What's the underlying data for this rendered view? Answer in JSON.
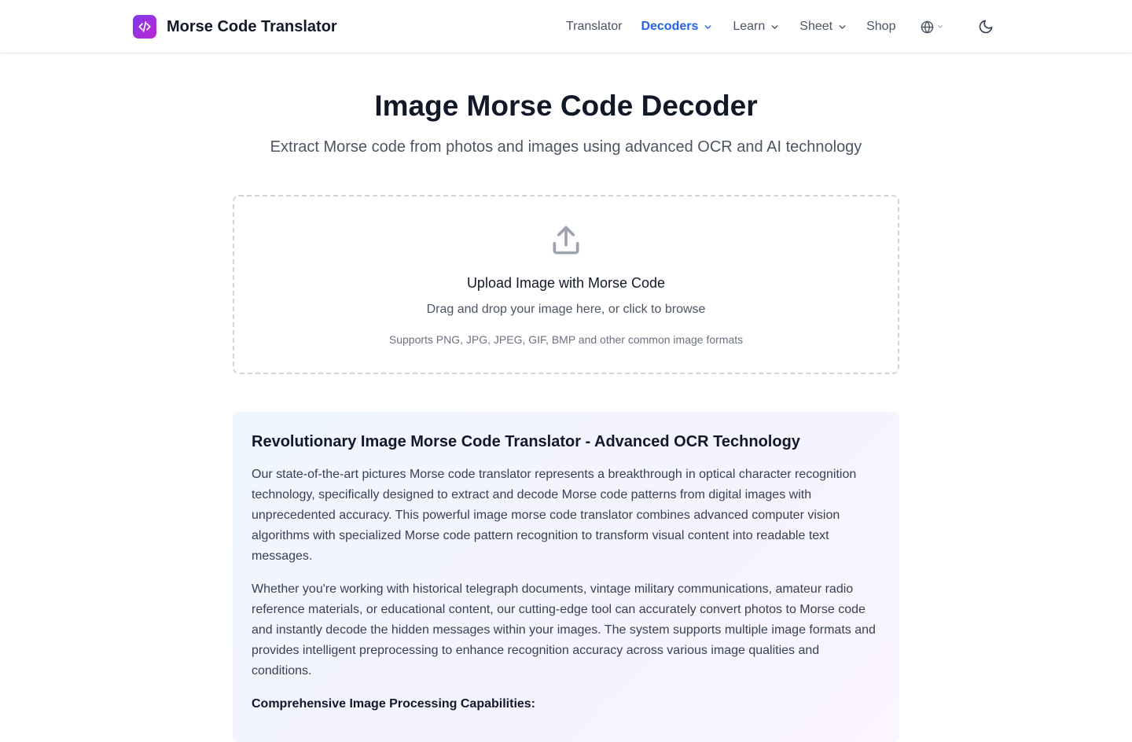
{
  "header": {
    "brand_name": "Morse Code Translator",
    "nav": {
      "translator": "Translator",
      "decoders": "Decoders",
      "learn": "Learn",
      "sheet": "Sheet",
      "shop": "Shop"
    },
    "active_nav": "Decoders"
  },
  "hero": {
    "title": "Image Morse Code Decoder",
    "subtitle": "Extract Morse code from photos and images using advanced OCR and AI technology"
  },
  "upload": {
    "title": "Upload Image with Morse Code",
    "description": "Drag and drop your image here, or click to browse",
    "formats": "Supports PNG, JPG, JPEG, GIF, BMP and other common image formats"
  },
  "info": {
    "title": "Revolutionary Image Morse Code Translator - Advanced OCR Technology",
    "paragraph_1": "Our state-of-the-art pictures Morse code translator represents a breakthrough in optical character recognition technology, specifically designed to extract and decode Morse code patterns from digital images with unprecedented accuracy. This powerful image morse code translator combines advanced computer vision algorithms with specialized Morse code pattern recognition to transform visual content into readable text messages.",
    "paragraph_2": "Whether you're working with historical telegraph documents, vintage military communications, amateur radio reference materials, or educational content, our cutting-edge tool can accurately convert photos to Morse code and instantly decode the hidden messages within your images. The system supports multiple image formats and provides intelligent preprocessing to enhance recognition accuracy across various image qualities and conditions.",
    "subheading": "Comprehensive Image Processing Capabilities:"
  },
  "colors": {
    "accent": "#2563eb",
    "brand_gradient_start": "#7c3aed",
    "brand_gradient_end": "#c026d3",
    "text_primary": "#111827",
    "text_secondary": "#4b5563"
  },
  "icons": {
    "brand": "code-icon",
    "dropdown": "chevron-down-icon",
    "language": "globe-icon",
    "theme": "moon-icon",
    "upload": "upload-icon"
  }
}
